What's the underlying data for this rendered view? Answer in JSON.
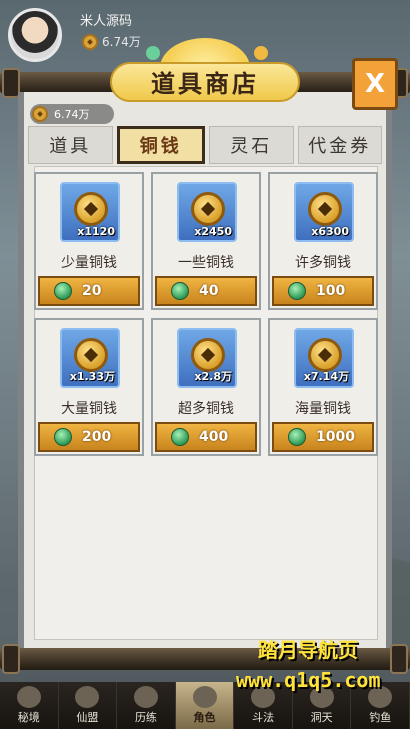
{
  "player": {
    "name": "米人源码",
    "coins": "6.74万"
  },
  "shop": {
    "title": "道具商店",
    "close_label": "X",
    "coin_balance": "6.74万",
    "tabs": [
      {
        "label": "道具",
        "active": false
      },
      {
        "label": "铜钱",
        "active": true
      },
      {
        "label": "灵石",
        "active": false
      },
      {
        "label": "代金券",
        "active": false
      }
    ],
    "items": [
      {
        "name": "少量铜钱",
        "qty": "x1120",
        "price": "20"
      },
      {
        "name": "一些铜钱",
        "qty": "x2450",
        "price": "40"
      },
      {
        "name": "许多铜钱",
        "qty": "x6300",
        "price": "100"
      },
      {
        "name": "大量铜钱",
        "qty": "x1.33万",
        "price": "200"
      },
      {
        "name": "超多铜钱",
        "qty": "x2.8万",
        "price": "400"
      },
      {
        "name": "海量铜钱",
        "qty": "x7.14万",
        "price": "1000"
      }
    ]
  },
  "bottom_nav": [
    {
      "label": "秘境",
      "icon": "secret-realm-icon"
    },
    {
      "label": "仙盟",
      "icon": "alliance-icon"
    },
    {
      "label": "历练",
      "icon": "training-icon"
    },
    {
      "label": "角色",
      "icon": "character-icon",
      "active": true
    },
    {
      "label": "斗法",
      "icon": "duel-icon"
    },
    {
      "label": "洞天",
      "icon": "cave-icon"
    },
    {
      "label": "钓鱼",
      "icon": "fishing-icon"
    }
  ],
  "watermark": {
    "line1": "踏月导航页",
    "line2": "www.q1q5.com"
  }
}
